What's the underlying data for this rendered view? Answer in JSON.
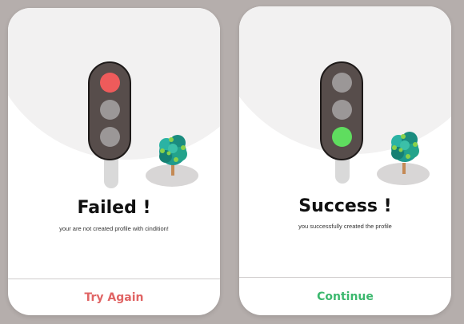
{
  "cards": {
    "failed": {
      "title": "Failed !",
      "message": "your are not created profile with cindition!",
      "button_label": "Try Again",
      "accent_color": "#e06464",
      "active_lamp": "red",
      "active_lamp_color": "#ee5b5b"
    },
    "success": {
      "title": "Success !",
      "message": "you successfully created the profile",
      "button_label": "Continue",
      "accent_color": "#3cb86e",
      "active_lamp": "green",
      "active_lamp_color": "#5fdd5f"
    }
  },
  "icons": {
    "traffic_light": "traffic-light-icon",
    "tree": "tree-icon"
  },
  "colors": {
    "background": "#b5aeac",
    "card": "#ffffff",
    "lamp_off": "#9b9797",
    "light_body": "#574d4b"
  }
}
